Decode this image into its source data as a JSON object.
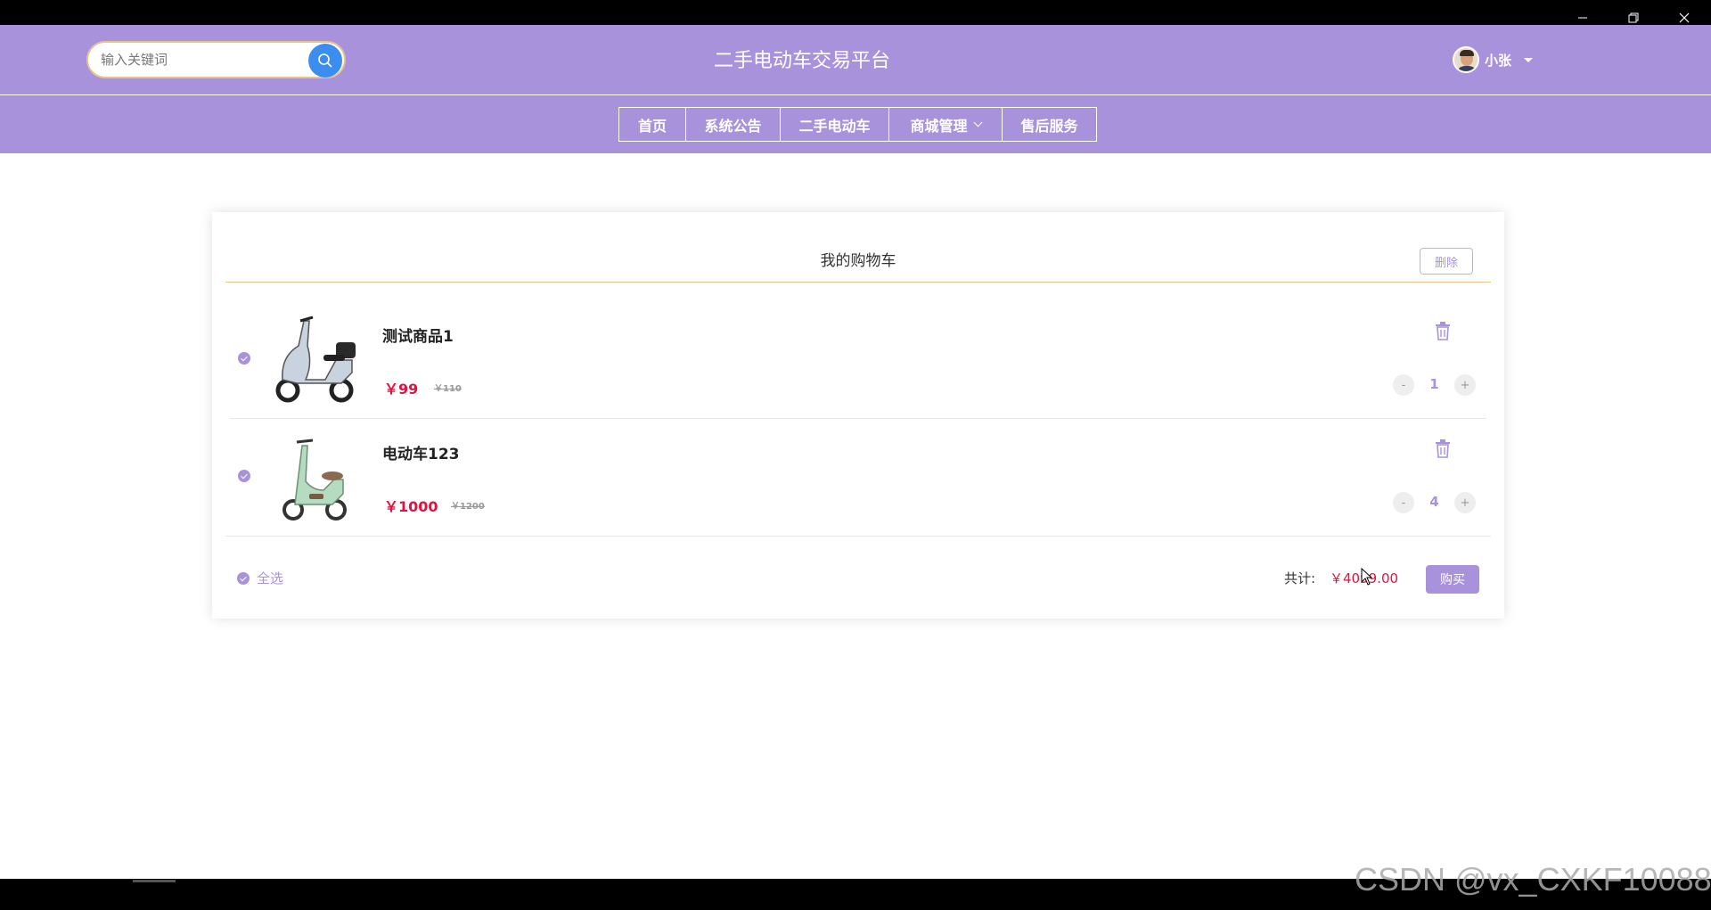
{
  "search": {
    "placeholder": "输入关键词"
  },
  "header": {
    "title": "二手电动车交易平台",
    "username": "小张"
  },
  "nav": {
    "items": [
      {
        "label": "首页"
      },
      {
        "label": "系统公告"
      },
      {
        "label": "二手电动车"
      },
      {
        "label": "商城管理",
        "has_dropdown": true
      },
      {
        "label": "售后服务"
      }
    ]
  },
  "cart": {
    "title": "我的购物车",
    "delete_label": "删除",
    "items": [
      {
        "name": "测试商品1",
        "price": "￥99",
        "original_price": "￥110",
        "quantity": "1",
        "checked": true
      },
      {
        "name": "电动车123",
        "price": "￥1000",
        "original_price": "￥1200",
        "quantity": "4",
        "checked": true
      }
    ],
    "select_all_label": "全选",
    "total_label": "共计:",
    "total_value": "￥4099.00",
    "buy_label": "购买",
    "minus_label": "-",
    "plus_label": "+"
  },
  "watermark": "CSDN @vx_CXKF10088",
  "colors": {
    "header_bg": "#a992dc",
    "accent": "#a992dc",
    "price": "#e2123f",
    "search_btn": "#3b8ef0"
  }
}
